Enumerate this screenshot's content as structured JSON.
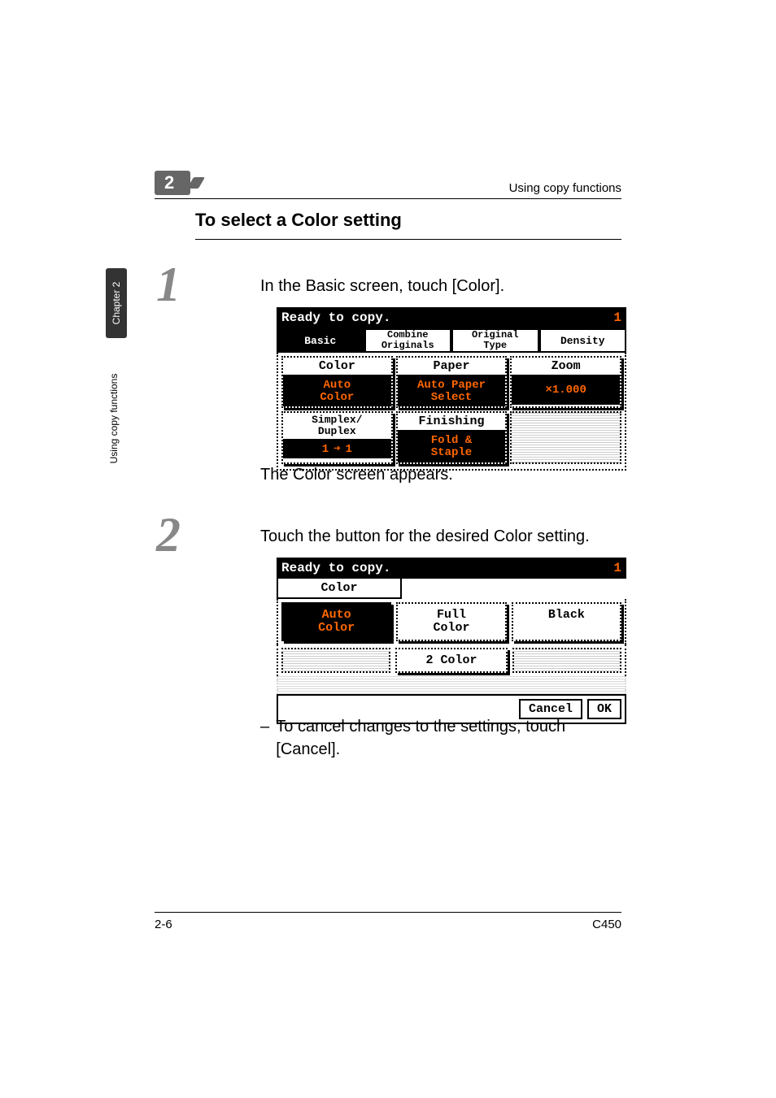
{
  "running_head": {
    "chapter_badge_number": "2",
    "right_text": "Using copy functions"
  },
  "heading": "To select a Color setting",
  "side_tab": {
    "dark": "Chapter 2",
    "light": "Using copy functions"
  },
  "steps": {
    "s1": {
      "number": "1",
      "text": "In the Basic screen, touch [Color].",
      "after_text": "The Color screen appears."
    },
    "s2": {
      "number": "2",
      "text": "Touch the button for the desired Color setting.",
      "note_dash": "–",
      "note_text": "To cancel changes to the settings, touch [Cancel]."
    }
  },
  "lcd1": {
    "status": "Ready to copy.",
    "count": "1",
    "tabs": {
      "basic": "Basic",
      "combine_line1": "Combine",
      "combine_line2": "Originals",
      "original_line1": "Original",
      "original_line2": "Type",
      "density": "Density"
    },
    "tiles": {
      "color_hdr": "Color",
      "color_val_line1": "Auto",
      "color_val_line2": "Color",
      "paper_hdr": "Paper",
      "paper_val_line1": "Auto Paper",
      "paper_val_line2": "Select",
      "zoom_hdr": "Zoom",
      "zoom_val": "×1.000",
      "simplex_hdr_line1": "Simplex/",
      "simplex_hdr_line2": "Duplex",
      "simplex_val_left": "1",
      "simplex_val_right": "1",
      "finish_hdr": "Finishing",
      "finish_val_line1": "Fold &",
      "finish_val_line2": "Staple"
    }
  },
  "lcd2": {
    "status": "Ready to copy.",
    "count": "1",
    "tab": "Color",
    "options": {
      "auto_line1": "Auto",
      "auto_line2": "Color",
      "full_line1": "Full",
      "full_line2": "Color",
      "black": "Black",
      "two_color": "2 Color"
    },
    "buttons": {
      "cancel": "Cancel",
      "ok": "OK"
    }
  },
  "footer": {
    "left": "2-6",
    "right": "C450"
  }
}
